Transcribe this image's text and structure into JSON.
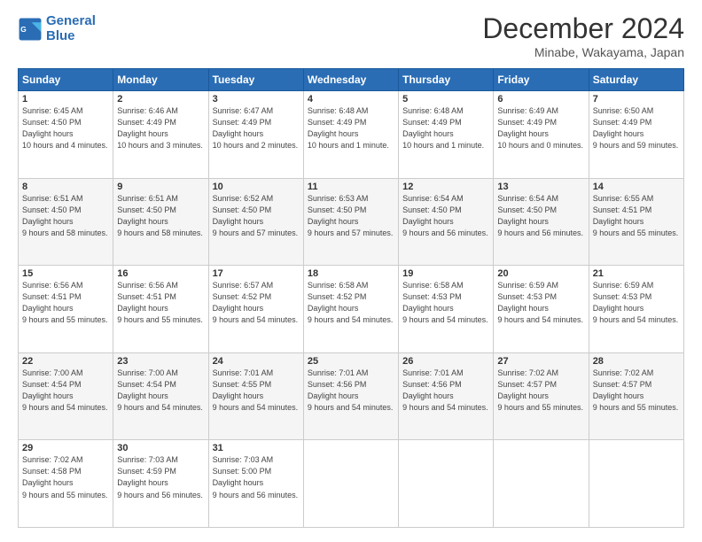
{
  "logo": {
    "line1": "General",
    "line2": "Blue"
  },
  "header": {
    "month": "December 2024",
    "location": "Minabe, Wakayama, Japan"
  },
  "weekdays": [
    "Sunday",
    "Monday",
    "Tuesday",
    "Wednesday",
    "Thursday",
    "Friday",
    "Saturday"
  ],
  "weeks": [
    [
      {
        "day": "1",
        "sunrise": "6:45 AM",
        "sunset": "4:50 PM",
        "daylight": "10 hours and 4 minutes."
      },
      {
        "day": "2",
        "sunrise": "6:46 AM",
        "sunset": "4:49 PM",
        "daylight": "10 hours and 3 minutes."
      },
      {
        "day": "3",
        "sunrise": "6:47 AM",
        "sunset": "4:49 PM",
        "daylight": "10 hours and 2 minutes."
      },
      {
        "day": "4",
        "sunrise": "6:48 AM",
        "sunset": "4:49 PM",
        "daylight": "10 hours and 1 minute."
      },
      {
        "day": "5",
        "sunrise": "6:48 AM",
        "sunset": "4:49 PM",
        "daylight": "10 hours and 1 minute."
      },
      {
        "day": "6",
        "sunrise": "6:49 AM",
        "sunset": "4:49 PM",
        "daylight": "10 hours and 0 minutes."
      },
      {
        "day": "7",
        "sunrise": "6:50 AM",
        "sunset": "4:49 PM",
        "daylight": "9 hours and 59 minutes."
      }
    ],
    [
      {
        "day": "8",
        "sunrise": "6:51 AM",
        "sunset": "4:50 PM",
        "daylight": "9 hours and 58 minutes."
      },
      {
        "day": "9",
        "sunrise": "6:51 AM",
        "sunset": "4:50 PM",
        "daylight": "9 hours and 58 minutes."
      },
      {
        "day": "10",
        "sunrise": "6:52 AM",
        "sunset": "4:50 PM",
        "daylight": "9 hours and 57 minutes."
      },
      {
        "day": "11",
        "sunrise": "6:53 AM",
        "sunset": "4:50 PM",
        "daylight": "9 hours and 57 minutes."
      },
      {
        "day": "12",
        "sunrise": "6:54 AM",
        "sunset": "4:50 PM",
        "daylight": "9 hours and 56 minutes."
      },
      {
        "day": "13",
        "sunrise": "6:54 AM",
        "sunset": "4:50 PM",
        "daylight": "9 hours and 56 minutes."
      },
      {
        "day": "14",
        "sunrise": "6:55 AM",
        "sunset": "4:51 PM",
        "daylight": "9 hours and 55 minutes."
      }
    ],
    [
      {
        "day": "15",
        "sunrise": "6:56 AM",
        "sunset": "4:51 PM",
        "daylight": "9 hours and 55 minutes."
      },
      {
        "day": "16",
        "sunrise": "6:56 AM",
        "sunset": "4:51 PM",
        "daylight": "9 hours and 55 minutes."
      },
      {
        "day": "17",
        "sunrise": "6:57 AM",
        "sunset": "4:52 PM",
        "daylight": "9 hours and 54 minutes."
      },
      {
        "day": "18",
        "sunrise": "6:58 AM",
        "sunset": "4:52 PM",
        "daylight": "9 hours and 54 minutes."
      },
      {
        "day": "19",
        "sunrise": "6:58 AM",
        "sunset": "4:53 PM",
        "daylight": "9 hours and 54 minutes."
      },
      {
        "day": "20",
        "sunrise": "6:59 AM",
        "sunset": "4:53 PM",
        "daylight": "9 hours and 54 minutes."
      },
      {
        "day": "21",
        "sunrise": "6:59 AM",
        "sunset": "4:53 PM",
        "daylight": "9 hours and 54 minutes."
      }
    ],
    [
      {
        "day": "22",
        "sunrise": "7:00 AM",
        "sunset": "4:54 PM",
        "daylight": "9 hours and 54 minutes."
      },
      {
        "day": "23",
        "sunrise": "7:00 AM",
        "sunset": "4:54 PM",
        "daylight": "9 hours and 54 minutes."
      },
      {
        "day": "24",
        "sunrise": "7:01 AM",
        "sunset": "4:55 PM",
        "daylight": "9 hours and 54 minutes."
      },
      {
        "day": "25",
        "sunrise": "7:01 AM",
        "sunset": "4:56 PM",
        "daylight": "9 hours and 54 minutes."
      },
      {
        "day": "26",
        "sunrise": "7:01 AM",
        "sunset": "4:56 PM",
        "daylight": "9 hours and 54 minutes."
      },
      {
        "day": "27",
        "sunrise": "7:02 AM",
        "sunset": "4:57 PM",
        "daylight": "9 hours and 55 minutes."
      },
      {
        "day": "28",
        "sunrise": "7:02 AM",
        "sunset": "4:57 PM",
        "daylight": "9 hours and 55 minutes."
      }
    ],
    [
      {
        "day": "29",
        "sunrise": "7:02 AM",
        "sunset": "4:58 PM",
        "daylight": "9 hours and 55 minutes."
      },
      {
        "day": "30",
        "sunrise": "7:03 AM",
        "sunset": "4:59 PM",
        "daylight": "9 hours and 56 minutes."
      },
      {
        "day": "31",
        "sunrise": "7:03 AM",
        "sunset": "5:00 PM",
        "daylight": "9 hours and 56 minutes."
      },
      null,
      null,
      null,
      null
    ]
  ]
}
